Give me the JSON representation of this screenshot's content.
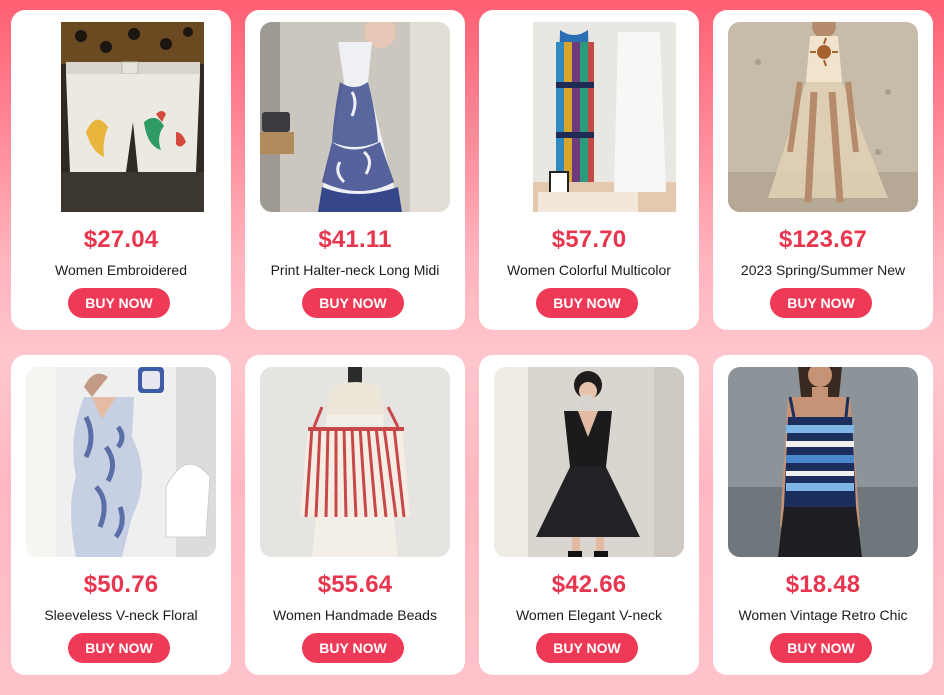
{
  "accent_color": "#ef3a57",
  "price_color": "#e8364f",
  "products": [
    {
      "price": "$27.04",
      "title": "Women Embroidered",
      "button": "BUY NOW",
      "image": "embroidered-shorts-photo"
    },
    {
      "price": "$41.11",
      "title": "Print Halter-neck Long Midi",
      "button": "BUY NOW",
      "image": "blue-print-halter-dress-photo"
    },
    {
      "price": "$57.70",
      "title": "Women Colorful Multicolor",
      "button": "BUY NOW",
      "image": "multicolor-knit-dress-photo"
    },
    {
      "price": "$123.67",
      "title": "2023 Spring/Summer New",
      "button": "BUY NOW",
      "image": "sheer-beige-maxi-dress-photo"
    },
    {
      "price": "$50.76",
      "title": "Sleeveless V-neck Floral",
      "button": "BUY NOW",
      "image": "floral-slip-dress-photo"
    },
    {
      "price": "$55.64",
      "title": "Women Handmade Beads",
      "button": "BUY NOW",
      "image": "beaded-crochet-top-photo"
    },
    {
      "price": "$42.66",
      "title": "Women Elegant V-neck",
      "button": "BUY NOW",
      "image": "black-vneck-dress-photo"
    },
    {
      "price": "$18.48",
      "title": "Women Vintage Retro Chic",
      "button": "BUY NOW",
      "image": "striped-knit-tank-photo"
    }
  ]
}
